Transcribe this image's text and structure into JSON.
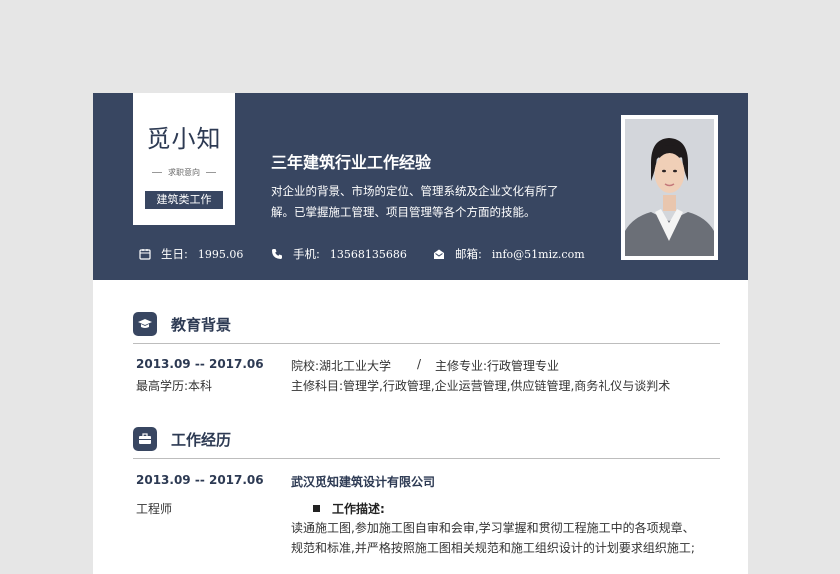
{
  "profile": {
    "name": "觅小知",
    "intent_label": "求职意向",
    "job_title": "建筑类工作",
    "headline": "三年建筑行业工作经验",
    "summary_line1": "对企业的背景、市场的定位、管理系统及企业文化有所了",
    "summary_line2": "解。已掌握施工管理、项目管理等各个方面的技能。"
  },
  "contact": {
    "birthday_label": "生日:",
    "birthday": "1995.06",
    "phone_label": "手机:",
    "phone": "13568135686",
    "email_label": "邮箱:",
    "email": "info@51miz.com"
  },
  "education": {
    "title": "教育背景",
    "period": "2013.09 -- 2017.06",
    "school": "院校:湖北工业大学",
    "separator": "/",
    "major": "主修专业:行政管理专业",
    "degree": "最高学历:本科",
    "courses": "主修科目:管理学,行政管理,企业运营管理,供应链管理,商务礼仪与谈判术"
  },
  "work": {
    "title": "工作经历",
    "period": "2013.09 -- 2017.06",
    "company": "武汉觅知建筑设计有限公司",
    "role": "工程师",
    "desc_label": "工作描述:",
    "desc_line1": "读通施工图,参加施工图自审和会审,学习掌握和贯彻工程施工中的各项规章、",
    "desc_line2": "规范和标准,并严格按照施工图相关规范和施工组织设计的计划要求组织施工;"
  },
  "watermark_text": "觅知网",
  "colors": {
    "navy": "#384661",
    "title_navy": "#2d3a53",
    "background": "#e6e6e6"
  }
}
